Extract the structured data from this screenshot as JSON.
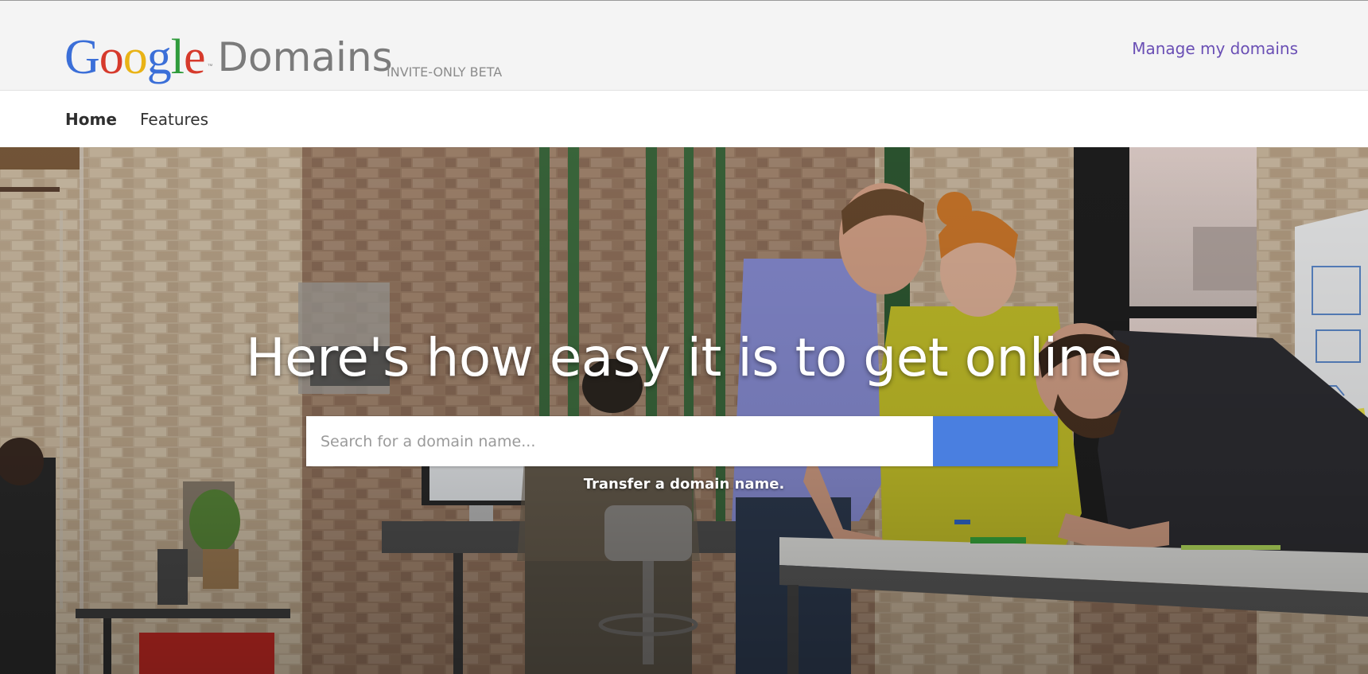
{
  "header": {
    "logo_letters": [
      "G",
      "o",
      "o",
      "g",
      "l",
      "e"
    ],
    "logo_trademark": "™",
    "product_name": "Domains",
    "beta_label": "INVITE-ONLY BETA",
    "manage_link": "Manage my domains"
  },
  "nav": {
    "items": [
      {
        "label": "Home",
        "active": true
      },
      {
        "label": "Features",
        "active": false
      }
    ]
  },
  "hero": {
    "title": "Here's how easy it is to get online",
    "search": {
      "placeholder": "Search for a domain name...",
      "value": "",
      "button_icon": "search-icon"
    },
    "transfer_link": "Transfer a domain name."
  },
  "colors": {
    "header_bg": "#f4f4f4",
    "manage_link": "#6a4fb5",
    "search_button": "#4a7fe0",
    "google_blue": "#3b6fd8",
    "google_red": "#d63a2c",
    "google_yellow": "#e9b316",
    "google_green": "#2f9b3b"
  }
}
